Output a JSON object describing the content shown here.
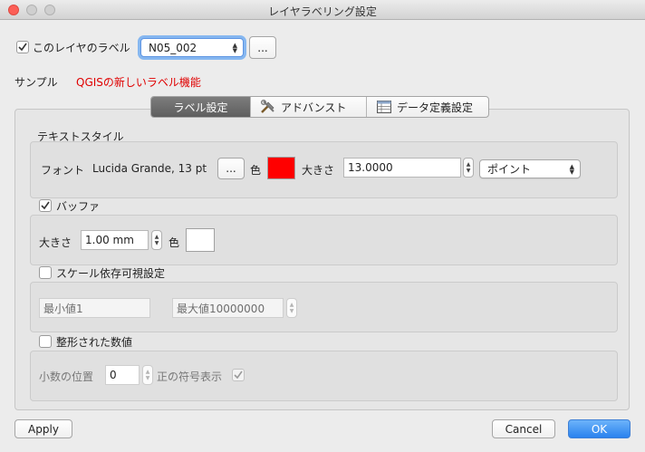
{
  "window": {
    "title": "レイヤラベリング設定"
  },
  "header": {
    "enable_label": "このレイヤのラベル",
    "enable_checked": true,
    "field_value": "N05_002",
    "more_button": "...",
    "sample_label": "サンプル",
    "sample_text": "QGISの新しいラベル機能"
  },
  "tabs": [
    {
      "label": "ラベル設定",
      "active": true
    },
    {
      "label": "アドバンスト",
      "icon": "tools-icon"
    },
    {
      "label": "データ定義設定",
      "icon": "table-icon"
    }
  ],
  "text_style": {
    "title": "テキストスタイル",
    "font_label": "フォント",
    "font_value": "Lucida Grande, 13 pt",
    "font_button": "...",
    "color_label": "色",
    "color_value": "#ff0000",
    "size_label": "大きさ",
    "size_value": "13.0000",
    "unit_value": "ポイント"
  },
  "buffer": {
    "title": "バッファ",
    "checked": true,
    "size_label": "大きさ",
    "size_value": "1.00 mm",
    "color_label": "色",
    "color_value": "#ffffff"
  },
  "scale": {
    "title": "スケール依存可視設定",
    "checked": false,
    "min_value": "最小値1",
    "max_value": "最大値10000000"
  },
  "numbers": {
    "title": "整形された数値",
    "checked": false,
    "decimals_label": "小数の位置",
    "decimals_value": "0",
    "plus_sign_label": "正の符号表示",
    "plus_sign_checked": true
  },
  "footer": {
    "apply": "Apply",
    "cancel": "Cancel",
    "ok": "OK"
  },
  "colors": {
    "accent": "#2a82ee",
    "sample_red": "#e00000"
  }
}
